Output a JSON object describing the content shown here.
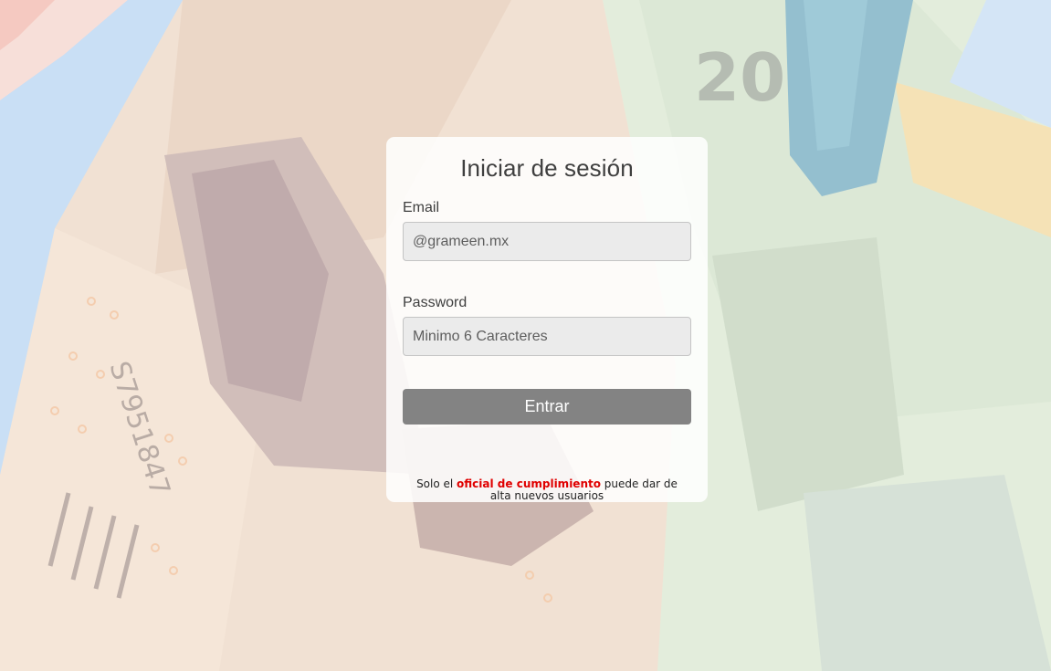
{
  "login": {
    "title": "Iniciar de sesión",
    "email_label": "Email",
    "email_placeholder": "@grameen.mx",
    "password_label": "Password",
    "password_placeholder": "Minimo 6 Caracteres",
    "submit_label": "Entrar",
    "note_prefix": "Solo el ",
    "note_highlight": "oficial de cumplimiento",
    "note_suffix": " puede dar de alta nuevos usuarios"
  },
  "colors": {
    "sky": "#a9cdf0",
    "button": "#838383",
    "highlight": "#e00000"
  }
}
